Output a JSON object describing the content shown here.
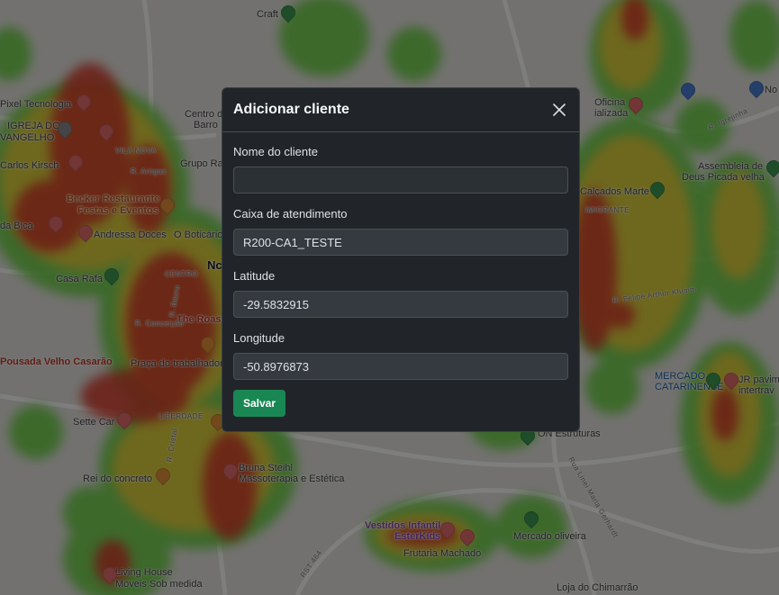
{
  "modal": {
    "title": "Adicionar cliente",
    "fields": [
      {
        "label": "Nome do cliente",
        "value": ""
      },
      {
        "label": "Caixa de atendimento",
        "value": "R200-CA1_TESTE"
      },
      {
        "label": "Latitude",
        "value": "-29.5832915"
      },
      {
        "label": "Longitude",
        "value": "-50.8976873"
      }
    ],
    "save_label": "Salvar"
  },
  "map": {
    "labels": [
      "Pixel Tecnologia",
      "IGREJA DO",
      "VANGELHO",
      "Carlos Kirsch",
      "VILA NOVA",
      "Becker Restaurante",
      "Festas e Eventos",
      "da Bica",
      "Andressa Doces",
      "O Boticário",
      "Casa Rafa",
      "CENTRO",
      "The Roast",
      "Pousada Velho Casarão",
      "Praça do trabalhador",
      "Sette Car",
      "LIBERDADE",
      "Rei do concreto",
      "Bruna Steihl",
      "Massoterapia e Estética",
      "Living House",
      "Moveis Sob medida",
      "Vestidos Infantil",
      "EsterKids",
      "Frutaria Machado",
      "Mercado oliveira",
      "Loja do Chimarrão",
      "MERCADO",
      "CATARINENSE",
      "JR pavim",
      "intertrav",
      "Assembleia de",
      "Deus Picada velha",
      "Calçados Marte",
      "Craft",
      "Centro de",
      "Barro",
      "Grupo Rai",
      "No",
      "Nc",
      "ON Estruturas",
      "IMIGRANTE",
      "R. Felipe Arthur Klumm",
      "R. Igrejinha",
      "RST 464",
      "Rua Linei Maria Gerhardt",
      "R. Artigas",
      "R. Cristal",
      "R. Bauru",
      "R. Conceição",
      "Oficina",
      "ializada"
    ]
  },
  "colors": {
    "modal_bg": "#212529",
    "save_button": "#198754",
    "heat_red": "#d93a2b",
    "heat_yellow": "#e8d03a",
    "heat_green": "#6fd14a"
  }
}
